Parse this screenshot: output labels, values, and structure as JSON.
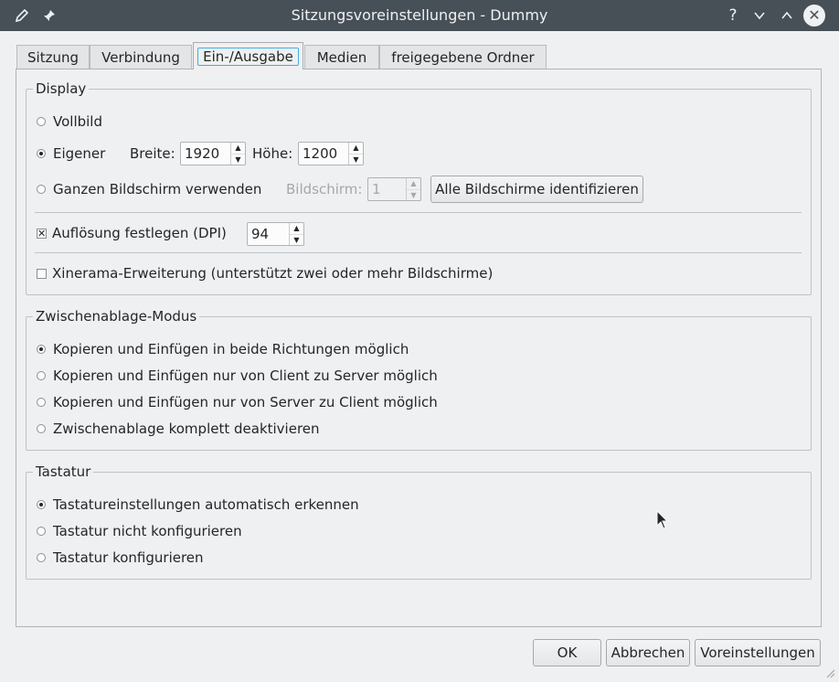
{
  "window": {
    "title": "Sitzungsvoreinstellungen - Dummy",
    "help_glyph": "?",
    "minimize_glyph": "⌄",
    "maximize_glyph": "⌃",
    "close_glyph": "✕"
  },
  "tabs": [
    {
      "label": "Sitzung"
    },
    {
      "label": "Verbindung"
    },
    {
      "label": "Ein-/Ausgabe",
      "active": true
    },
    {
      "label": "Medien"
    },
    {
      "label": "freigegebene Ordner"
    }
  ],
  "display": {
    "title": "Display",
    "fullscreen_label": "Vollbild",
    "custom_label": "Eigener",
    "width_label": "Breite:",
    "width_value": "1920",
    "height_label": "Höhe:",
    "height_value": "1200",
    "whole_screen_label": "Ganzen Bildschirm verwenden",
    "screen_label": "Bildschirm:",
    "screen_value": "1",
    "identify_button": "Alle Bildschirme identifizieren",
    "dpi_label": "Auflösung festlegen (DPI)",
    "dpi_value": "94",
    "xinerama_label": "Xinerama-Erweiterung (unterstützt zwei oder mehr Bildschirme)"
  },
  "clipboard": {
    "title": "Zwischenablage-Modus",
    "options": [
      "Kopieren und Einfügen in beide Richtungen möglich",
      "Kopieren und Einfügen nur von Client zu Server möglich",
      "Kopieren und Einfügen nur von Server zu Client möglich",
      "Zwischenablage komplett deaktivieren"
    ]
  },
  "keyboard": {
    "title": "Tastatur",
    "options": [
      "Tastatureinstellungen automatisch erkennen",
      "Tastatur nicht konfigurieren",
      "Tastatur konfigurieren"
    ]
  },
  "buttons": {
    "ok": "OK",
    "cancel": "Abbrechen",
    "defaults": "Voreinstellungen"
  },
  "icons": {
    "app": "pencil-icon",
    "pin": "pin-icon",
    "help": "help-icon",
    "minimize": "chevron-down-icon",
    "maximize": "chevron-up-icon",
    "close": "close-icon"
  }
}
